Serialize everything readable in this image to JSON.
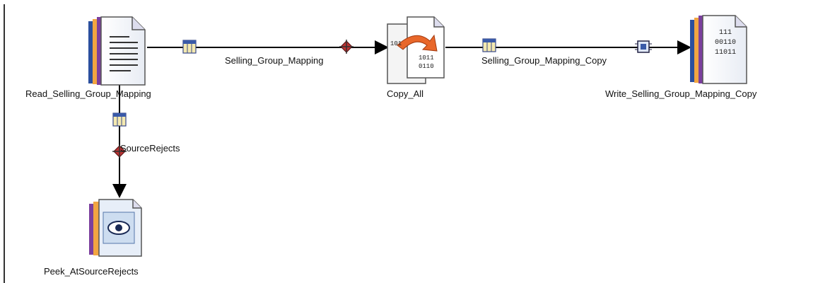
{
  "stages": [
    {
      "id": "read",
      "label": "Read_Selling_Group_Mapping",
      "icon": "sequential-file-icon"
    },
    {
      "id": "copy",
      "label": "Copy_All",
      "icon": "copy-stage-icon"
    },
    {
      "id": "write",
      "label": "Write_Selling_Group_Mapping_Copy",
      "icon": "dataset-file-icon"
    },
    {
      "id": "peek",
      "label": "Peek_AtSourceRejects",
      "icon": "peek-stage-icon"
    }
  ],
  "links": [
    {
      "from": "read",
      "to": "copy",
      "label": "Selling_Group_Mapping"
    },
    {
      "from": "copy",
      "to": "write",
      "label": "Selling_Group_Mapping_Copy"
    },
    {
      "from": "read",
      "to": "peek",
      "label": "SourceRejects"
    }
  ],
  "write_icon_text": [
    "111",
    "00110",
    "11011"
  ],
  "copy_icon_text": [
    "101",
    "1011",
    "0110"
  ]
}
